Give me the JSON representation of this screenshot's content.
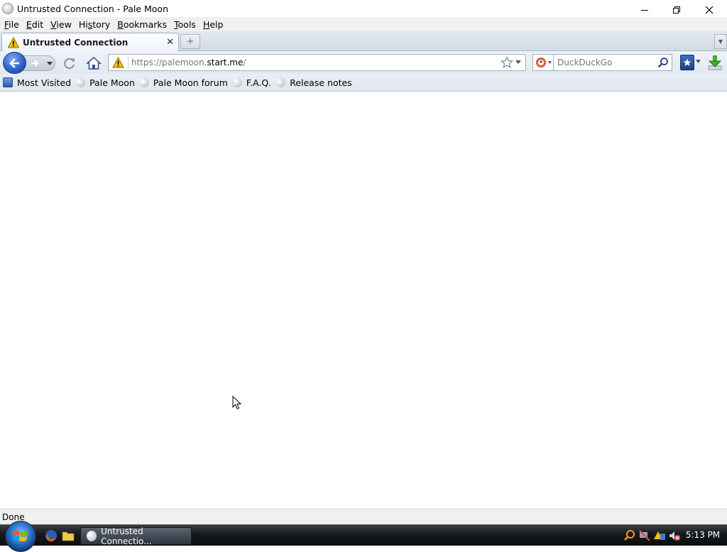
{
  "window": {
    "title": "Untrusted Connection - Pale Moon"
  },
  "menu": [
    {
      "label": "File",
      "u": "F",
      "rest": "ile"
    },
    {
      "label": "Edit",
      "u": "E",
      "rest": "dit"
    },
    {
      "label": "View",
      "u": "V",
      "rest": "iew"
    },
    {
      "label": "History",
      "u": "s",
      "pre": "Hi",
      "rest": "tory"
    },
    {
      "label": "Bookmarks",
      "u": "B",
      "rest": "ookmarks"
    },
    {
      "label": "Tools",
      "u": "T",
      "rest": "ools"
    },
    {
      "label": "Help",
      "u": "H",
      "rest": "elp"
    }
  ],
  "tab": {
    "title": "Untrusted Connection",
    "close": "✕",
    "new_tab": "+"
  },
  "urlbar": {
    "prefix": "https://palemoon.",
    "domain": "start.me",
    "suffix": "/"
  },
  "search": {
    "placeholder": "DuckDuckGo"
  },
  "bookmarks": [
    {
      "label": "Most Visited",
      "icon": "most-visited-icon"
    },
    {
      "label": "Pale Moon",
      "icon": "globe-icon"
    },
    {
      "label": "Pale Moon forum",
      "icon": "globe-icon"
    },
    {
      "label": "F.A.Q.",
      "icon": "globe-icon"
    },
    {
      "label": "Release notes",
      "icon": "globe-icon"
    }
  ],
  "status": {
    "text": "Done"
  },
  "taskbar": {
    "task_label": "Untrusted Connectio...",
    "clock": "5:13 PM"
  },
  "colors": {
    "accent": "#2a5cc9",
    "warning": "#f2c200",
    "taskbar": "#15191d"
  }
}
